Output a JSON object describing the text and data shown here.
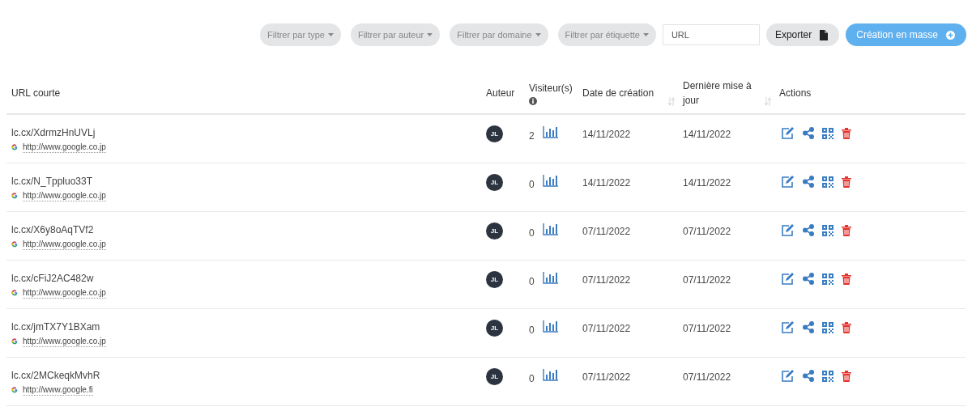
{
  "toolbar": {
    "filters": [
      "Filtrer par type",
      "Filtrer par auteur",
      "Filtrer par domaine",
      "Filtrer par étiquette"
    ],
    "url_field": {
      "placeholder": "URL"
    },
    "export_button": "Exporter",
    "bulk_button": "Création en masse"
  },
  "table": {
    "columns": [
      "URL courte",
      "Auteur",
      "Visiteur(s)",
      "Date de création",
      "Dernière mise à jour",
      "Actions"
    ],
    "rows": [
      {
        "short_url": "lc.cx/XdrmzHnUVLj",
        "target": "http://www.google.co.jp",
        "author": "JL",
        "visitors": "2",
        "created": "14/11/2022",
        "updated": "14/11/2022"
      },
      {
        "short_url": "lc.cx/N_Tppluo33T",
        "target": "http://www.google.co.jp",
        "author": "JL",
        "visitors": "0",
        "created": "14/11/2022",
        "updated": "14/11/2022"
      },
      {
        "short_url": "lc.cx/X6y8oAqTVf2",
        "target": "http://www.google.co.jp",
        "author": "JL",
        "visitors": "0",
        "created": "07/11/2022",
        "updated": "07/11/2022"
      },
      {
        "short_url": "lc.cx/cFiJ2AC482w",
        "target": "http://www.google.co.jp",
        "author": "JL",
        "visitors": "0",
        "created": "07/11/2022",
        "updated": "07/11/2022"
      },
      {
        "short_url": "lc.cx/jmTX7Y1BXam",
        "target": "http://www.google.co.jp",
        "author": "JL",
        "visitors": "0",
        "created": "07/11/2022",
        "updated": "07/11/2022"
      },
      {
        "short_url": "lc.cx/2MCkeqkMvhR",
        "target": "http://www.google.fi",
        "author": "JL",
        "visitors": "0",
        "created": "07/11/2022",
        "updated": "07/11/2022"
      }
    ]
  }
}
